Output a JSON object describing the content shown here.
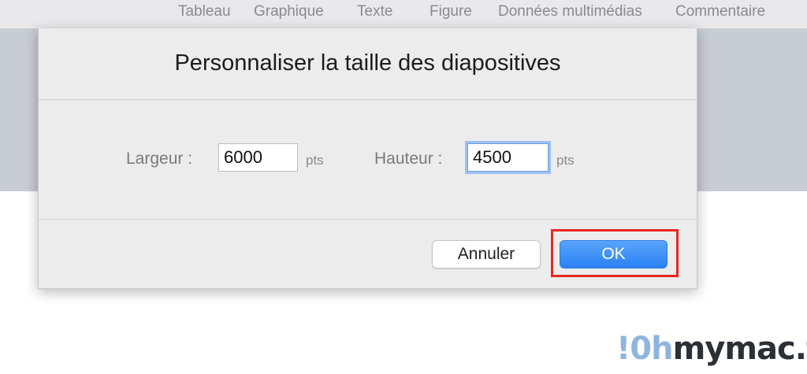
{
  "toolbar": {
    "items": [
      "Tableau",
      "Graphique",
      "Texte",
      "Figure",
      "Données multimédias",
      "Commentaire"
    ]
  },
  "dialog": {
    "title": "Personnaliser la taille des diapositives",
    "width": {
      "label": "Largeur :",
      "value": "6000",
      "unit": "pts"
    },
    "height": {
      "label": "Hauteur :",
      "value": "4500",
      "unit": "pts"
    },
    "buttons": {
      "cancel": "Annuler",
      "ok": "OK"
    }
  },
  "annotation": {
    "highlight_color": "#e8271f",
    "highlights": "OK"
  },
  "watermark": {
    "mark": "!0h",
    "rest": "mymac.fr"
  },
  "colors": {
    "accent": "#2a82f5"
  }
}
